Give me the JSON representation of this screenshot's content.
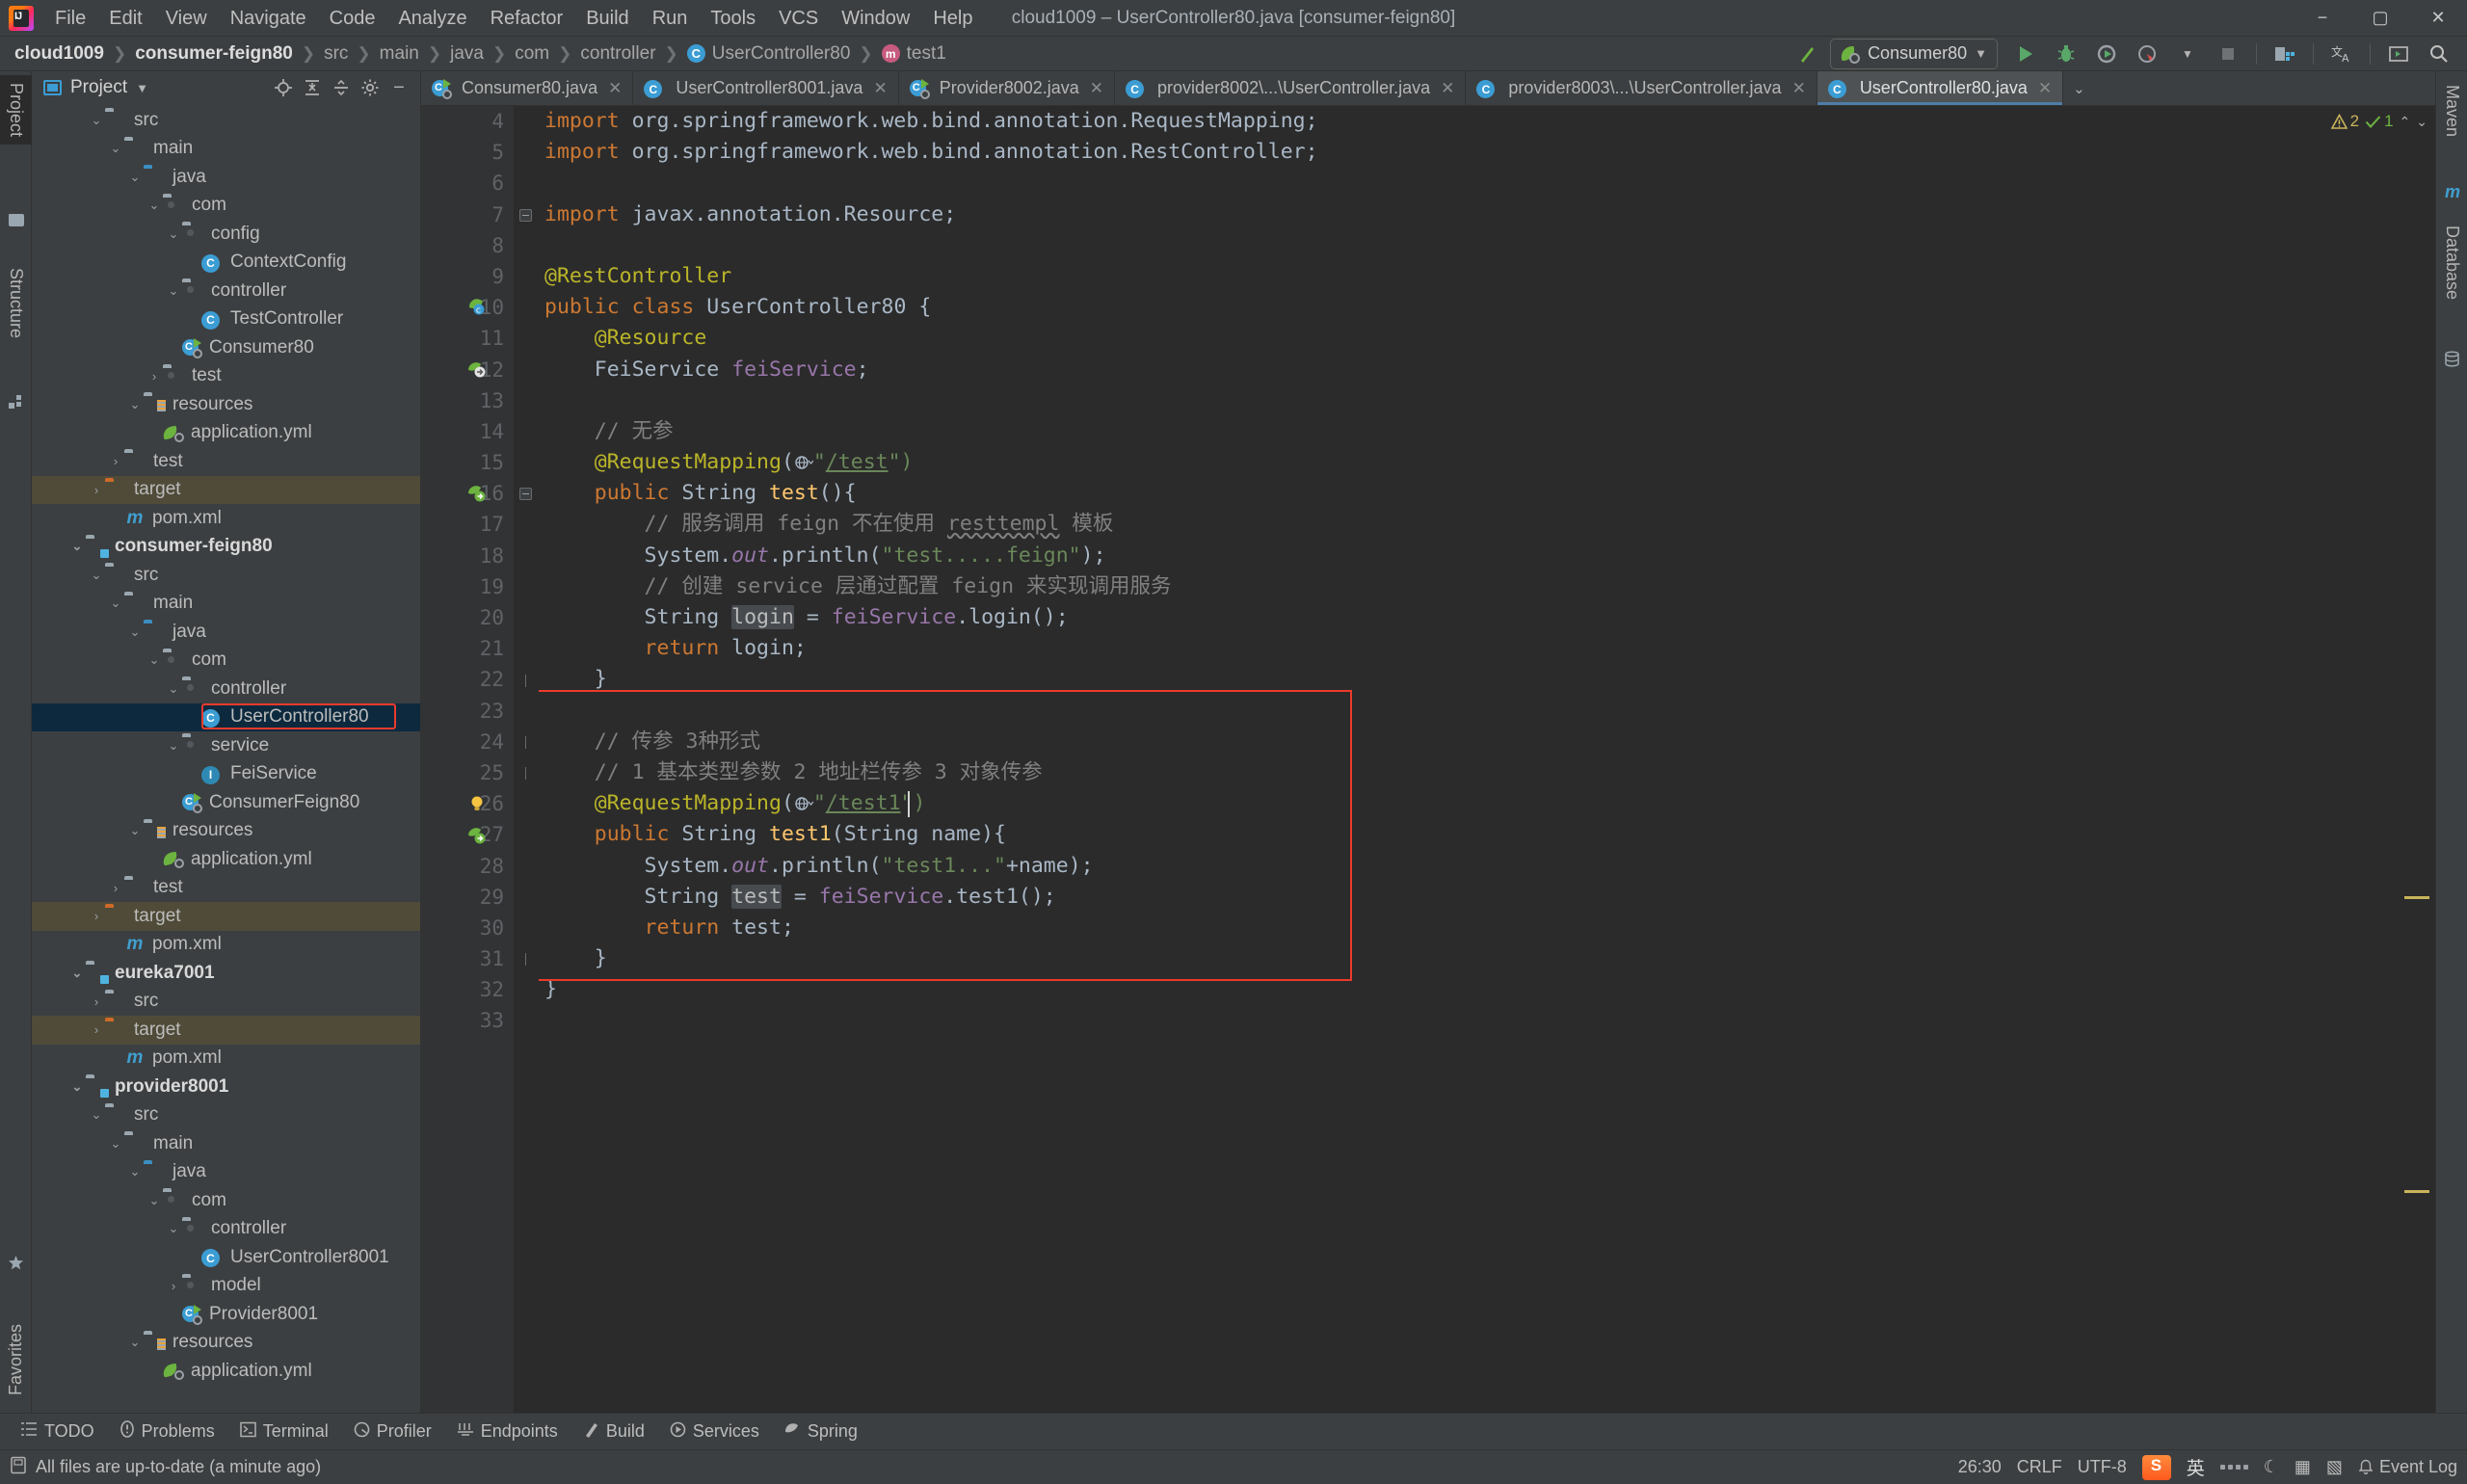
{
  "window": {
    "title": "cloud1009 – UserController80.java [consumer-feign80]",
    "minimize": "−",
    "maximize": "▢",
    "close": "✕"
  },
  "menu": [
    "File",
    "Edit",
    "View",
    "Navigate",
    "Code",
    "Analyze",
    "Refactor",
    "Build",
    "Run",
    "Tools",
    "VCS",
    "Window",
    "Help"
  ],
  "breadcrumb": [
    {
      "label": "cloud1009",
      "bold": true,
      "icon": null
    },
    {
      "label": "consumer-feign80",
      "bold": true,
      "icon": null
    },
    {
      "label": "src",
      "bold": false,
      "icon": null
    },
    {
      "label": "main",
      "bold": false,
      "icon": null
    },
    {
      "label": "java",
      "bold": false,
      "icon": null
    },
    {
      "label": "com",
      "bold": false,
      "icon": null
    },
    {
      "label": "controller",
      "bold": false,
      "icon": null
    },
    {
      "label": "UserController80",
      "bold": false,
      "icon": "class-icon"
    },
    {
      "label": "test1",
      "bold": false,
      "icon": "method-icon"
    }
  ],
  "toolbar": {
    "build_label": "build-icon",
    "run_config": "Consumer80",
    "run": "run-icon",
    "debug": "debug-icon",
    "run_coverage": "coverage-icon",
    "profiler": "profiler-icon",
    "stop": "stop-icon",
    "project_structure": "project-structure-icon",
    "translate": "translate-icon",
    "terminal": "terminal-icon",
    "search": "search-icon"
  },
  "left_stripes": [
    {
      "label": "Project",
      "selected": true
    },
    {
      "label": "Structure",
      "selected": false
    }
  ],
  "right_stripes": [
    {
      "label": "Maven",
      "selected": false
    },
    {
      "label": "Database",
      "selected": false
    }
  ],
  "bottom_left_stripe": {
    "label": "Favorites"
  },
  "project_panel": {
    "title": "Project",
    "tools": [
      "locate-icon",
      "expand-all-icon",
      "collapse-all-icon",
      "settings-icon",
      "hide-icon"
    ],
    "tree": [
      {
        "indent": 2,
        "arrow": "down",
        "icon": "folder-grey",
        "label": "src"
      },
      {
        "indent": 3,
        "arrow": "down",
        "icon": "folder-grey",
        "label": "main"
      },
      {
        "indent": 4,
        "arrow": "down",
        "icon": "folder-blue",
        "label": "java"
      },
      {
        "indent": 5,
        "arrow": "down",
        "icon": "folder-pkg",
        "label": "com"
      },
      {
        "indent": 6,
        "arrow": "down",
        "icon": "folder-pkg",
        "label": "config"
      },
      {
        "indent": 7,
        "arrow": "none",
        "icon": "class",
        "label": "ContextConfig"
      },
      {
        "indent": 6,
        "arrow": "down",
        "icon": "folder-pkg",
        "label": "controller"
      },
      {
        "indent": 7,
        "arrow": "none",
        "icon": "class",
        "label": "TestController"
      },
      {
        "indent": 6,
        "arrow": "none",
        "icon": "spring-boot",
        "label": "Consumer80"
      },
      {
        "indent": 5,
        "arrow": "right",
        "icon": "folder-pkg",
        "label": "test"
      },
      {
        "indent": 4,
        "arrow": "down",
        "icon": "folder-res",
        "label": "resources"
      },
      {
        "indent": 5,
        "arrow": "none",
        "icon": "yml",
        "label": "application.yml"
      },
      {
        "indent": 3,
        "arrow": "right",
        "icon": "folder-grey",
        "label": "test"
      },
      {
        "indent": 2,
        "arrow": "right",
        "icon": "folder-orange",
        "label": "target",
        "target": true
      },
      {
        "indent": 3,
        "arrow": "none",
        "icon": "maven",
        "label": "pom.xml"
      },
      {
        "indent": 1,
        "arrow": "down",
        "icon": "folder-module",
        "label": "consumer-feign80",
        "bold": true
      },
      {
        "indent": 2,
        "arrow": "down",
        "icon": "folder-grey",
        "label": "src"
      },
      {
        "indent": 3,
        "arrow": "down",
        "icon": "folder-grey",
        "label": "main"
      },
      {
        "indent": 4,
        "arrow": "down",
        "icon": "folder-blue",
        "label": "java"
      },
      {
        "indent": 5,
        "arrow": "down",
        "icon": "folder-pkg",
        "label": "com"
      },
      {
        "indent": 6,
        "arrow": "down",
        "icon": "folder-pkg",
        "label": "controller"
      },
      {
        "indent": 7,
        "arrow": "none",
        "icon": "class",
        "label": "UserController80",
        "selected": true,
        "boxed": true
      },
      {
        "indent": 6,
        "arrow": "down",
        "icon": "folder-pkg",
        "label": "service"
      },
      {
        "indent": 7,
        "arrow": "none",
        "icon": "interface",
        "label": "FeiService"
      },
      {
        "indent": 6,
        "arrow": "none",
        "icon": "spring-boot",
        "label": "ConsumerFeign80"
      },
      {
        "indent": 4,
        "arrow": "down",
        "icon": "folder-res",
        "label": "resources"
      },
      {
        "indent": 5,
        "arrow": "none",
        "icon": "yml",
        "label": "application.yml"
      },
      {
        "indent": 3,
        "arrow": "right",
        "icon": "folder-grey",
        "label": "test"
      },
      {
        "indent": 2,
        "arrow": "right",
        "icon": "folder-orange",
        "label": "target",
        "target": true
      },
      {
        "indent": 3,
        "arrow": "none",
        "icon": "maven",
        "label": "pom.xml"
      },
      {
        "indent": 1,
        "arrow": "down",
        "icon": "folder-module",
        "label": "eureka7001",
        "bold": true
      },
      {
        "indent": 2,
        "arrow": "right",
        "icon": "folder-grey",
        "label": "src"
      },
      {
        "indent": 2,
        "arrow": "right",
        "icon": "folder-orange",
        "label": "target",
        "target": true
      },
      {
        "indent": 3,
        "arrow": "none",
        "icon": "maven",
        "label": "pom.xml"
      },
      {
        "indent": 1,
        "arrow": "down",
        "icon": "folder-module",
        "label": "provider8001",
        "bold": true
      },
      {
        "indent": 2,
        "arrow": "down",
        "icon": "folder-grey",
        "label": "src"
      },
      {
        "indent": 3,
        "arrow": "down",
        "icon": "folder-grey",
        "label": "main"
      },
      {
        "indent": 4,
        "arrow": "down",
        "icon": "folder-blue",
        "label": "java"
      },
      {
        "indent": 5,
        "arrow": "down",
        "icon": "folder-pkg",
        "label": "com"
      },
      {
        "indent": 6,
        "arrow": "down",
        "icon": "folder-pkg",
        "label": "controller"
      },
      {
        "indent": 7,
        "arrow": "none",
        "icon": "class",
        "label": "UserController8001"
      },
      {
        "indent": 6,
        "arrow": "right",
        "icon": "folder-pkg",
        "label": "model"
      },
      {
        "indent": 6,
        "arrow": "none",
        "icon": "spring-boot",
        "label": "Provider8001"
      },
      {
        "indent": 4,
        "arrow": "down",
        "icon": "folder-res",
        "label": "resources"
      },
      {
        "indent": 5,
        "arrow": "none",
        "icon": "yml",
        "label": "application.yml"
      }
    ]
  },
  "editor": {
    "tabs": [
      {
        "label": "Consumer80.java",
        "icon": "spring-boot",
        "active": false
      },
      {
        "label": "UserController8001.java",
        "icon": "class",
        "active": false
      },
      {
        "label": "Provider8002.java",
        "icon": "spring-boot",
        "active": false
      },
      {
        "label": "provider8002\\...\\UserController.java",
        "icon": "class",
        "active": false
      },
      {
        "label": "provider8003\\...\\UserController.java",
        "icon": "class",
        "active": false
      },
      {
        "label": "UserController80.java",
        "icon": "class",
        "active": true
      }
    ],
    "tab_overflow": "⌄",
    "inspections": {
      "warnings": "2",
      "warn_icon": "warning-icon",
      "ok": "1",
      "ok_icon": "checkmark-icon",
      "up": "⌃",
      "down": "⌄"
    },
    "first_line_number": 4,
    "lines": [
      {
        "n": 4,
        "tokens": [
          {
            "t": "import ",
            "c": "kw"
          },
          {
            "t": "org.springframework.web.bind.annotation.",
            "c": "id"
          },
          {
            "t": "RequestMapping",
            "c": "typ"
          },
          {
            "t": ";",
            "c": "id"
          }
        ]
      },
      {
        "n": 5,
        "tokens": [
          {
            "t": "import ",
            "c": "kw"
          },
          {
            "t": "org.springframework.web.bind.annotation.",
            "c": "id"
          },
          {
            "t": "RestController",
            "c": "typ"
          },
          {
            "t": ";",
            "c": "id"
          }
        ]
      },
      {
        "n": 6,
        "tokens": []
      },
      {
        "n": 7,
        "tokens": [
          {
            "t": "import ",
            "c": "kw"
          },
          {
            "t": "javax.annotation.",
            "c": "id"
          },
          {
            "t": "Resource",
            "c": "typ"
          },
          {
            "t": ";",
            "c": "id"
          }
        ],
        "fold": "start"
      },
      {
        "n": 8,
        "tokens": []
      },
      {
        "n": 9,
        "tokens": [
          {
            "t": "@RestController",
            "c": "ann"
          }
        ]
      },
      {
        "n": 10,
        "tokens": [
          {
            "t": "public class ",
            "c": "kw"
          },
          {
            "t": "UserController80",
            "c": "id"
          },
          {
            "t": " {",
            "c": "id"
          }
        ],
        "gutter": "spring-bean"
      },
      {
        "n": 11,
        "tokens": [
          {
            "t": "    @Resource",
            "c": "ann"
          }
        ]
      },
      {
        "n": 12,
        "tokens": [
          {
            "t": "    ",
            "c": "id"
          },
          {
            "t": "FeiService",
            "c": "typ"
          },
          {
            "t": " ",
            "c": "id"
          },
          {
            "t": "feiService",
            "c": "fld"
          },
          {
            "t": ";",
            "c": "id"
          }
        ],
        "gutter": "spring-inject"
      },
      {
        "n": 13,
        "tokens": []
      },
      {
        "n": 14,
        "tokens": [
          {
            "t": "    // 无参",
            "c": "cmt"
          }
        ]
      },
      {
        "n": 15,
        "tokens": [
          {
            "t": "    @RequestMapping",
            "c": "ann"
          },
          {
            "t": "(",
            "c": "id"
          },
          {
            "t": "GLOBE",
            "c": "icon"
          },
          {
            "t": "\"",
            "c": "str"
          },
          {
            "t": "/test",
            "c": "lnk"
          },
          {
            "t": "\")",
            "c": "str"
          }
        ]
      },
      {
        "n": 16,
        "tokens": [
          {
            "t": "    public ",
            "c": "kw"
          },
          {
            "t": "String ",
            "c": "typ"
          },
          {
            "t": "test",
            "c": "mth"
          },
          {
            "t": "(){",
            "c": "id"
          }
        ],
        "gutter": "spring-url",
        "fold": "start"
      },
      {
        "n": 17,
        "tokens": [
          {
            "t": "        // 服务调用 feign 不在使用 ",
            "c": "cmt"
          },
          {
            "t": "resttempl",
            "c": "cmt-u"
          },
          {
            "t": " 模板",
            "c": "cmt"
          }
        ]
      },
      {
        "n": 18,
        "tokens": [
          {
            "t": "        System.",
            "c": "id"
          },
          {
            "t": "out",
            "c": "stat"
          },
          {
            "t": ".println(",
            "c": "id"
          },
          {
            "t": "\"test.....feign\"",
            "c": "str"
          },
          {
            "t": ");",
            "c": "id"
          }
        ]
      },
      {
        "n": 19,
        "tokens": [
          {
            "t": "        // 创建 service 层通过配置 feign 来实现调用服务",
            "c": "cmt"
          }
        ]
      },
      {
        "n": 20,
        "tokens": [
          {
            "t": "        String ",
            "c": "typ"
          },
          {
            "t": "login",
            "c": "hl"
          },
          {
            "t": " = ",
            "c": "id"
          },
          {
            "t": "feiService",
            "c": "fld"
          },
          {
            "t": ".login();",
            "c": "id"
          }
        ]
      },
      {
        "n": 21,
        "tokens": [
          {
            "t": "        return ",
            "c": "kw"
          },
          {
            "t": "login;",
            "c": "id"
          }
        ]
      },
      {
        "n": 22,
        "tokens": [
          {
            "t": "    }",
            "c": "id"
          }
        ],
        "fold": "end"
      },
      {
        "n": 23,
        "tokens": []
      },
      {
        "n": 24,
        "tokens": [
          {
            "t": "    // 传参 3种形式",
            "c": "cmt"
          }
        ],
        "fold": "end"
      },
      {
        "n": 25,
        "tokens": [
          {
            "t": "    // 1 基本类型参数 2 地址栏传参 3 对象传参",
            "c": "cmt"
          }
        ],
        "fold": "end"
      },
      {
        "n": 26,
        "tokens": [
          {
            "t": "    @RequestMapping",
            "c": "ann"
          },
          {
            "t": "(",
            "c": "id"
          },
          {
            "t": "GLOBE",
            "c": "icon"
          },
          {
            "t": "\"",
            "c": "str"
          },
          {
            "t": "/test1",
            "c": "lnk"
          },
          {
            "t": "\")",
            "c": "str"
          }
        ],
        "gutter": "bulb",
        "caret": true
      },
      {
        "n": 27,
        "tokens": [
          {
            "t": "    public ",
            "c": "kw"
          },
          {
            "t": "String ",
            "c": "typ"
          },
          {
            "t": "test1",
            "c": "mth"
          },
          {
            "t": "(",
            "c": "id"
          },
          {
            "t": "String ",
            "c": "typ"
          },
          {
            "t": "name",
            "c": "id"
          },
          {
            "t": "){",
            "c": "id"
          }
        ],
        "gutter": "spring-url"
      },
      {
        "n": 28,
        "tokens": [
          {
            "t": "        System.",
            "c": "id"
          },
          {
            "t": "out",
            "c": "stat"
          },
          {
            "t": ".println(",
            "c": "id"
          },
          {
            "t": "\"test1...\"",
            "c": "str"
          },
          {
            "t": "+name);",
            "c": "id"
          }
        ]
      },
      {
        "n": 29,
        "tokens": [
          {
            "t": "        String ",
            "c": "typ"
          },
          {
            "t": "test",
            "c": "hl"
          },
          {
            "t": " = ",
            "c": "id"
          },
          {
            "t": "feiService",
            "c": "fld"
          },
          {
            "t": ".test1();",
            "c": "id"
          }
        ]
      },
      {
        "n": 30,
        "tokens": [
          {
            "t": "        return ",
            "c": "kw"
          },
          {
            "t": "test;",
            "c": "id"
          }
        ]
      },
      {
        "n": 31,
        "tokens": [
          {
            "t": "    }",
            "c": "id"
          }
        ],
        "fold": "end"
      },
      {
        "n": 32,
        "tokens": [
          {
            "t": "}",
            "c": "id"
          }
        ]
      },
      {
        "n": 33,
        "tokens": []
      }
    ]
  },
  "bottom_bar": [
    {
      "label": "TODO",
      "icon": "todo-icon"
    },
    {
      "label": "Problems",
      "icon": "problems-icon"
    },
    {
      "label": "Terminal",
      "icon": "terminal-icon"
    },
    {
      "label": "Profiler",
      "icon": "profiler-icon"
    },
    {
      "label": "Endpoints",
      "icon": "endpoints-icon"
    },
    {
      "label": "Build",
      "icon": "build-icon"
    },
    {
      "label": "Services",
      "icon": "services-icon"
    },
    {
      "label": "Spring",
      "icon": "spring-icon"
    }
  ],
  "status": {
    "message": "All files are up-to-date (a minute ago)",
    "message_icon": "save-icon",
    "caret_position": "26:30",
    "line_separator": "CRLF",
    "encoding": "UTF-8",
    "ime": "英",
    "event_log": "Event Log",
    "event_log_icon": "bell-icon"
  },
  "colors": {
    "accent_blue": "#3b9dd4",
    "spring_green": "#6cb33f",
    "target_orange": "#cf6a28",
    "highlight_box": "#ec3b2c",
    "selection": "#0d293e",
    "editor_bg": "#2b2b2b",
    "chrome_bg": "#3c3f41"
  }
}
